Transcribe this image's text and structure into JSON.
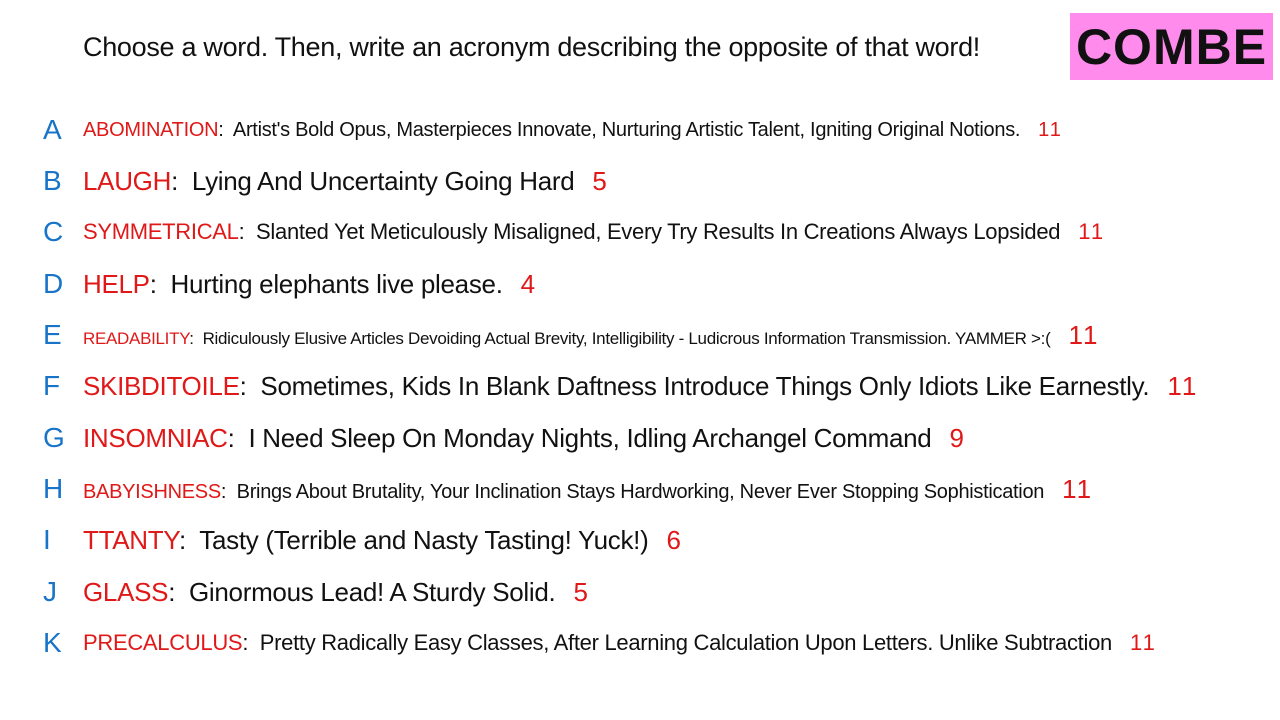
{
  "header": {
    "instruction": "Choose a word. Then, write an acronym describing the opposite of that word!",
    "badge": "COMBE"
  },
  "colors": {
    "letter": "#1874c8",
    "word": "#e01818",
    "badge_background": "#ff8bec"
  },
  "entries": [
    {
      "letter": "A",
      "word": "ABOMINATION",
      "acronym": "Artist's Bold Opus, Masterpieces Innovate, Nurturing Artistic Talent, Igniting Original Notions.",
      "count": "11"
    },
    {
      "letter": "B",
      "word": "LAUGH",
      "acronym": "Lying And Uncertainty Going Hard",
      "count": "5"
    },
    {
      "letter": "C",
      "word": "SYMMETRICAL",
      "acronym": "Slanted Yet Meticulously Misaligned, Every Try Results In Creations Always Lopsided",
      "count": "11"
    },
    {
      "letter": "D",
      "word": "HELP",
      "acronym": "Hurting elephants live please.",
      "count": "4"
    },
    {
      "letter": "E",
      "word": "READABILITY",
      "acronym": "Ridiculously Elusive Articles Devoiding Actual Brevity, Intelligibility - Ludicrous Information Transmission. YAMMER >:(",
      "count": "11"
    },
    {
      "letter": "F",
      "word": "SKIBDITOILE",
      "acronym": "Sometimes, Kids In Blank Daftness Introduce Things Only Idiots Like Earnestly.",
      "count": "11"
    },
    {
      "letter": "G",
      "word": "INSOMNIAC",
      "acronym": "I Need Sleep On Monday Nights, Idling Archangel Command",
      "count": "9"
    },
    {
      "letter": "H",
      "word": "BABYISHNESS",
      "acronym": "Brings About Brutality, Your Inclination Stays Hardworking, Never Ever Stopping Sophistication",
      "count": "11"
    },
    {
      "letter": "I",
      "word": "TTANTY",
      "acronym": "Tasty (Terrible and Nasty Tasting! Yuck!)",
      "count": "6"
    },
    {
      "letter": "J",
      "word": "GLASS",
      "acronym": "Ginormous Lead! A Sturdy Solid.",
      "count": "5"
    },
    {
      "letter": "K",
      "word": "PRECALCULUS",
      "acronym": "Pretty  Radically  Easy Classes, After Learning Calculation Upon Letters. Unlike Subtraction",
      "count": "11"
    }
  ]
}
